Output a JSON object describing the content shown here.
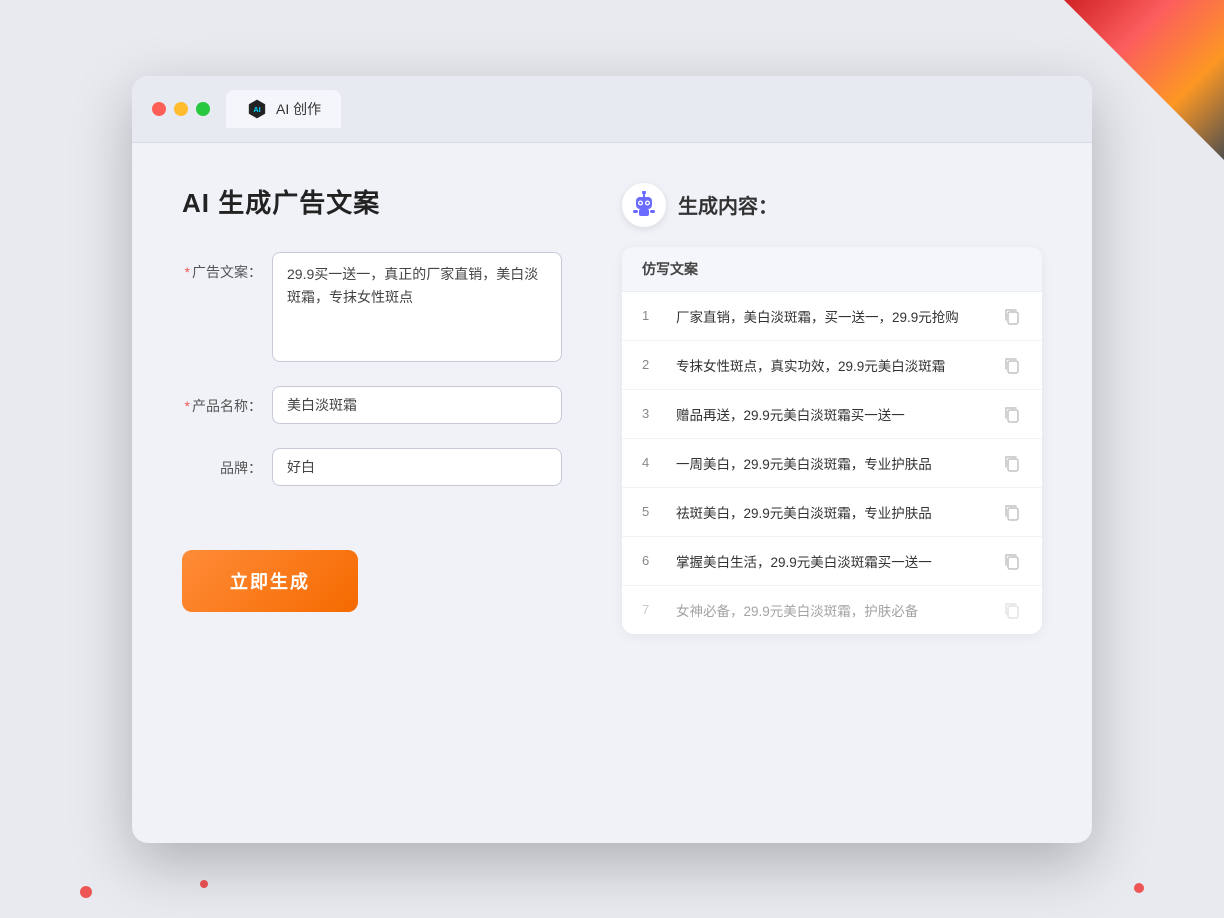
{
  "window": {
    "tab_label": "AI 创作"
  },
  "page": {
    "title": "AI 生成广告文案"
  },
  "form": {
    "ad_copy_label": "广告文案：",
    "ad_copy_required": true,
    "ad_copy_value": "29.9买一送一，真正的厂家直销，美白淡斑霜，专抹女性斑点",
    "product_name_label": "产品名称：",
    "product_name_required": true,
    "product_name_value": "美白淡斑霜",
    "brand_label": "品牌：",
    "brand_required": false,
    "brand_value": "好白",
    "submit_label": "立即生成"
  },
  "result": {
    "section_label": "生成内容：",
    "table_header": "仿写文案",
    "items": [
      {
        "num": "1",
        "text": "厂家直销，美白淡斑霜，买一送一，29.9元抢购",
        "dimmed": false
      },
      {
        "num": "2",
        "text": "专抹女性斑点，真实功效，29.9元美白淡斑霜",
        "dimmed": false
      },
      {
        "num": "3",
        "text": "赠品再送，29.9元美白淡斑霜买一送一",
        "dimmed": false
      },
      {
        "num": "4",
        "text": "一周美白，29.9元美白淡斑霜，专业护肤品",
        "dimmed": false
      },
      {
        "num": "5",
        "text": "祛斑美白，29.9元美白淡斑霜，专业护肤品",
        "dimmed": false
      },
      {
        "num": "6",
        "text": "掌握美白生活，29.9元美白淡斑霜买一送一",
        "dimmed": false
      },
      {
        "num": "7",
        "text": "女神必备，29.9元美白淡斑霜，护肤必备",
        "dimmed": true
      }
    ]
  }
}
